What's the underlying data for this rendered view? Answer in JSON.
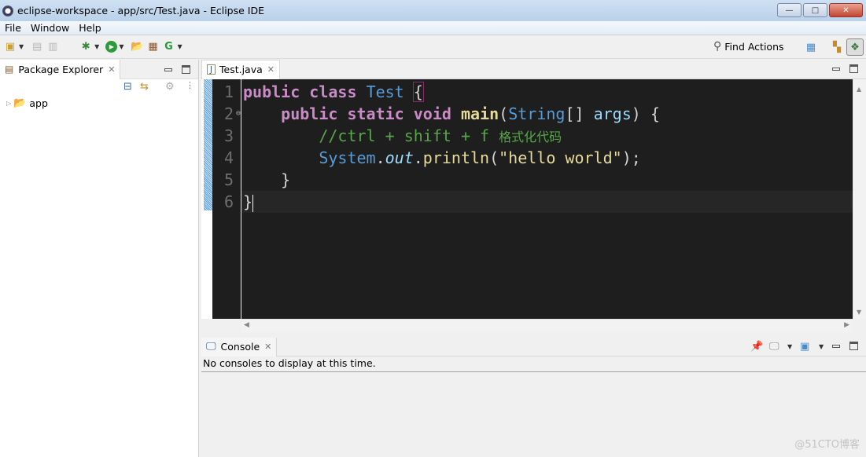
{
  "window": {
    "title": "eclipse-workspace - app/src/Test.java - Eclipse IDE",
    "controls": {
      "minimize": "—",
      "maximize": "□",
      "close": "✕"
    }
  },
  "menu": [
    "File",
    "Window",
    "Help"
  ],
  "toolbar": {
    "find_actions_label": "Find Actions",
    "icons": [
      "new-icon",
      "save-icon",
      "save-all-icon",
      "debug-icon",
      "run-icon",
      "new-java-project-icon",
      "new-package-icon",
      "new-class-icon"
    ],
    "perspective_icons": [
      "open-perspective-icon",
      "java-ee-perspective-icon",
      "java-perspective-icon"
    ]
  },
  "package_explorer": {
    "tab_label": "Package Explorer",
    "tree": [
      {
        "label": "app",
        "expanded": false
      }
    ]
  },
  "editor": {
    "tab_label": "Test.java",
    "line_numbers": [
      "1",
      "2",
      "3",
      "4",
      "5",
      "6"
    ],
    "lines": [
      [
        {
          "t": "public",
          "c": "kw"
        },
        {
          "t": " "
        },
        {
          "t": "class",
          "c": "kw"
        },
        {
          "t": " "
        },
        {
          "t": "Test",
          "c": "ty"
        },
        {
          "t": " "
        },
        {
          "t": "{",
          "c": "brk"
        }
      ],
      [
        {
          "t": "    "
        },
        {
          "t": "public",
          "c": "kw"
        },
        {
          "t": " "
        },
        {
          "t": "static",
          "c": "kw"
        },
        {
          "t": " "
        },
        {
          "t": "void",
          "c": "kw"
        },
        {
          "t": " "
        },
        {
          "t": "main",
          "c": "fn"
        },
        {
          "t": "("
        },
        {
          "t": "String",
          "c": "ty"
        },
        {
          "t": "[] "
        },
        {
          "t": "args",
          "c": "pm"
        },
        {
          "t": ") {"
        }
      ],
      [
        {
          "t": "        "
        },
        {
          "t": "//ctrl + shift + f ",
          "c": "cm"
        },
        {
          "t": "格式化代码",
          "c": "cmz"
        }
      ],
      [
        {
          "t": "        "
        },
        {
          "t": "System",
          "c": "ty"
        },
        {
          "t": "."
        },
        {
          "t": "out",
          "c": "it"
        },
        {
          "t": "."
        },
        {
          "t": "println",
          "c": "st"
        },
        {
          "t": "("
        },
        {
          "t": "\"hello world\"",
          "c": "st"
        },
        {
          "t": ");"
        }
      ],
      [
        {
          "t": "    "
        },
        {
          "t": "}"
        }
      ],
      [
        {
          "t": "}"
        }
      ]
    ],
    "current_line": 6
  },
  "console": {
    "tab_label": "Console",
    "message": "No consoles to display at this time."
  },
  "watermark": "@51CTO博客"
}
